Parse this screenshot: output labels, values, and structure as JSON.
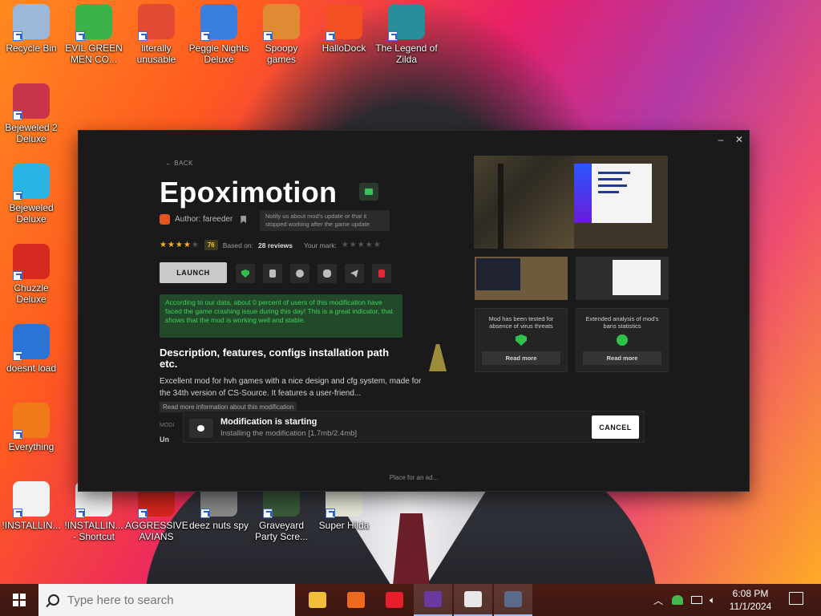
{
  "desktop": {
    "icons": [
      {
        "label": "Recycle Bin",
        "icon": "recycle-bin-icon",
        "color": "#9bb7d9"
      },
      {
        "label": "EVIL GREEN MEN CO...",
        "icon": "green-men-icon",
        "color": "#3bb24a"
      },
      {
        "label": "literally unusable",
        "icon": "chrome-icon",
        "color": "#e24a34"
      },
      {
        "label": "Peggle Nights Deluxe",
        "icon": "peggle-icon",
        "color": "#3a7fe0"
      },
      {
        "label": "Spoopy games",
        "icon": "folder-icon",
        "color": "#e08a34"
      },
      {
        "label": "HalloDock",
        "icon": "windows-shield-icon",
        "color": "#f25022"
      },
      {
        "label": "The Legend of Zilda",
        "icon": "zilda-icon",
        "color": "#2a8e9a"
      },
      {
        "label": "Bejeweled 2 Deluxe",
        "icon": "bejeweled2-icon",
        "color": "#c8344a"
      },
      {
        "label": "Bejeweled Deluxe",
        "icon": "bejeweled-icon",
        "color": "#2ab4e6"
      },
      {
        "label": "Chuzzle Deluxe",
        "icon": "chuzzle-icon",
        "color": "#d62a20"
      },
      {
        "label": "doesnt load",
        "icon": "thunderbird-icon",
        "color": "#2a74d6"
      },
      {
        "label": "Everything",
        "icon": "everything-icon",
        "color": "#f07a1a"
      },
      {
        "label": "!INSTALLIN...",
        "icon": "text-file-icon",
        "color": "#f2f2f2"
      },
      {
        "label": "!INSTALLIN... - Shortcut",
        "icon": "text-file-shortcut-icon",
        "color": "#f2f2f2"
      },
      {
        "label": "AGGRESSIVE AVIANS",
        "icon": "angry-birds-icon",
        "color": "#d6261e"
      },
      {
        "label": "deez nuts spy",
        "icon": "shortcut-icon",
        "color": "#8a8a8a"
      },
      {
        "label": "Graveyard Party Scre...",
        "icon": "graveyard-icon",
        "color": "#3a5a3a"
      },
      {
        "label": "Super Hilda",
        "icon": "hilda-icon",
        "color": "#e8e8d8"
      }
    ]
  },
  "app": {
    "back_label": "BACK",
    "title": "Epoximotion",
    "author": "Author: fareeder",
    "notify_text": "Notify us about mod's update or that it stopped working after the game update",
    "score": "76",
    "based_on_label": "Based on:",
    "reviews": "28 reviews",
    "your_mark_label": "Your mark:",
    "launch_label": "LAUNCH",
    "green_note": "According to our data, about 0 percent of users of this modification have faced the game crashing issue during this day! This is a great indicator, that shows that the mod is working well and stable.",
    "desc_title": "Description, features, configs installation path etc.",
    "desc_text": "Excellent mod for hvh games with a nice design and cfg system, made for the 34th version of CS-Source. It features a user-friend...",
    "read_more_info": "Read more information about this modification",
    "modi_label": "MODI",
    "un_text": "Un",
    "card_virus_title": "Mod has been tested for absence of virus threats",
    "card_bans_title": "Extended analysis of mod's bans statistics",
    "read_more": "Read more",
    "toast_title": "Modification is starting",
    "toast_sub": "Installing the modification [1.7mb/2.4mb]",
    "cancel_label": "CANCEL",
    "ad_text": "Place for an ad...",
    "minimize": "–",
    "close": "✕"
  },
  "taskbar": {
    "search_placeholder": "Type here to search",
    "time": "6:08 PM",
    "date": "11/1/2024",
    "apps": [
      {
        "icon": "file-explorer-icon",
        "color": "#f2c038"
      },
      {
        "icon": "firefox-icon",
        "color": "#f06a1e"
      },
      {
        "icon": "opera-icon",
        "color": "#e61e2a"
      },
      {
        "icon": "winrar-icon",
        "color": "#6a3aa0"
      },
      {
        "icon": "counter-strike-icon",
        "color": "#e8e8e8"
      },
      {
        "icon": "launcher-icon",
        "color": "#5a6a8a"
      }
    ]
  }
}
